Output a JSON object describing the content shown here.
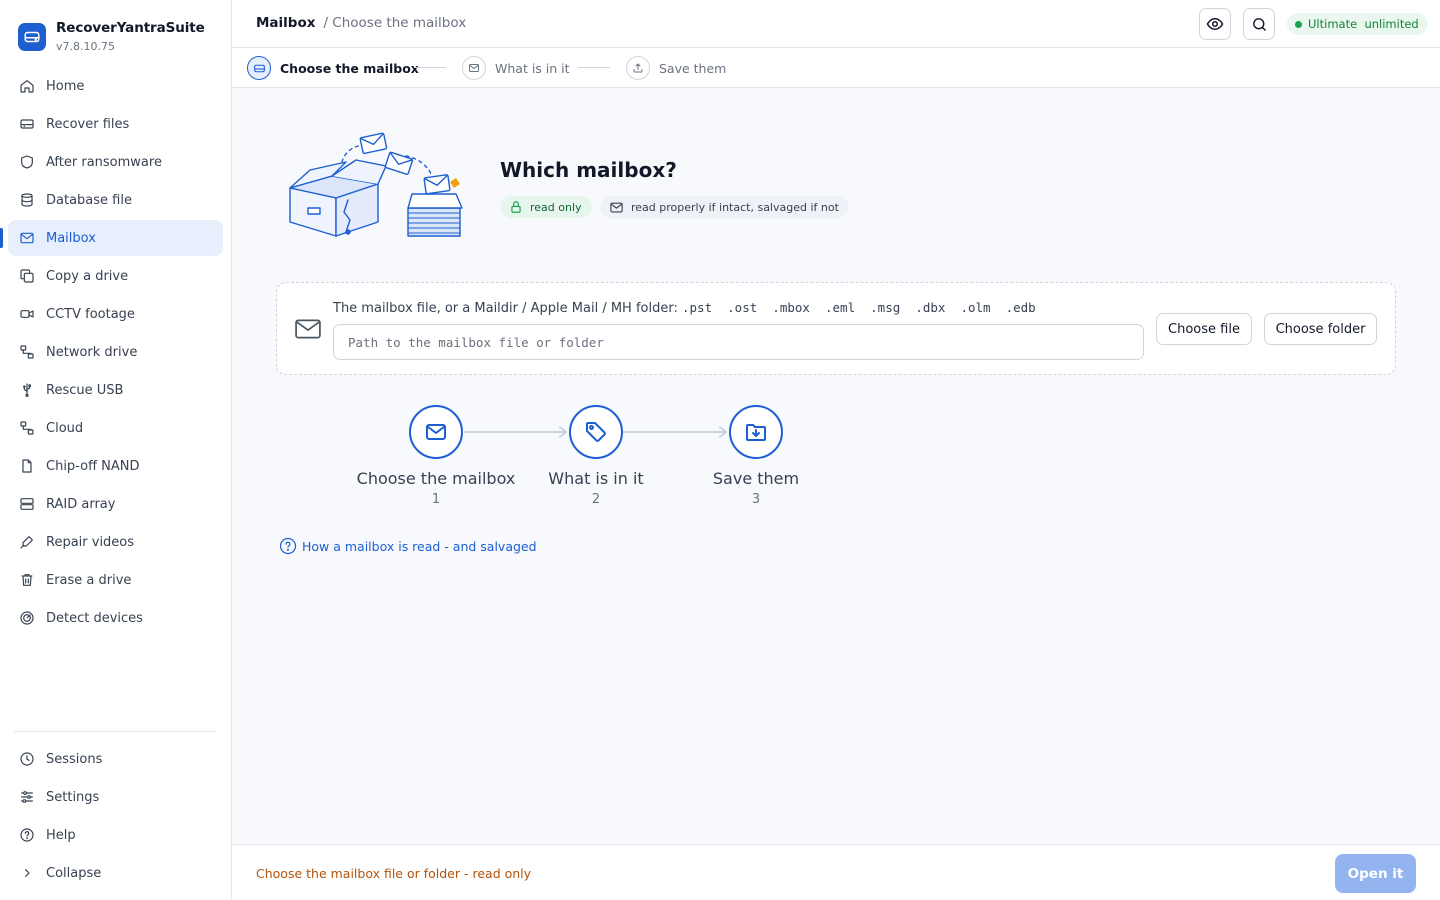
{
  "app": {
    "name": "RecoverYantraSuite",
    "version": "v7.8.10.75"
  },
  "sidebar": {
    "items": [
      {
        "label": "Home",
        "icon": "home-icon"
      },
      {
        "label": "Recover files",
        "icon": "drive-icon"
      },
      {
        "label": "After ransomware",
        "icon": "shield-icon"
      },
      {
        "label": "Database file",
        "icon": "database-icon"
      },
      {
        "label": "Mailbox",
        "icon": "mail-icon",
        "active": true
      },
      {
        "label": "Copy a drive",
        "icon": "copy-icon"
      },
      {
        "label": "CCTV footage",
        "icon": "camera-icon"
      },
      {
        "label": "Network drive",
        "icon": "network-icon"
      },
      {
        "label": "Rescue USB",
        "icon": "usb-icon"
      },
      {
        "label": "Cloud",
        "icon": "cloud-icon"
      },
      {
        "label": "Chip-off NAND",
        "icon": "chip-icon"
      },
      {
        "label": "RAID array",
        "icon": "raid-icon"
      },
      {
        "label": "Repair videos",
        "icon": "repair-icon"
      },
      {
        "label": "Erase a drive",
        "icon": "trash-icon"
      },
      {
        "label": "Detect devices",
        "icon": "radar-icon"
      }
    ],
    "bottom": [
      {
        "label": "Sessions",
        "icon": "clock-icon"
      },
      {
        "label": "Settings",
        "icon": "sliders-icon"
      },
      {
        "label": "Help",
        "icon": "help-icon"
      },
      {
        "label": "Collapse",
        "icon": "chevron-right-icon"
      }
    ]
  },
  "header": {
    "crumb_root": "Mailbox",
    "crumb_current": "/ Choose the mailbox",
    "plan_label": "Ultimate  unlimited"
  },
  "stepper": {
    "steps": [
      {
        "label": "Choose the mailbox",
        "active": true
      },
      {
        "label": "What is in it"
      },
      {
        "label": "Save them"
      }
    ]
  },
  "hero": {
    "title": "Which mailbox?",
    "badge_readonly": "read only",
    "badge_mode": "read properly if intact, salvaged if not"
  },
  "source": {
    "label": "The mailbox file, or a Maildir / Apple Mail / MH folder:",
    "extensions": ".pst  .ost  .mbox  .eml  .msg  .dbx  .olm  .edb",
    "placeholder": "Path to the mailbox file or folder",
    "value": "",
    "choose_file": "Choose file",
    "choose_folder": "Choose folder"
  },
  "flow": [
    {
      "label": "Choose the mailbox",
      "num": "1",
      "icon": "mail-icon"
    },
    {
      "label": "What is in it",
      "num": "2",
      "icon": "tag-icon"
    },
    {
      "label": "Save them",
      "num": "3",
      "icon": "folder-download-icon"
    }
  ],
  "help_link": "How a mailbox is read - and salvaged",
  "footer": {
    "status": "Choose the mailbox file or folder - read only",
    "open_button": "Open it"
  },
  "colors": {
    "accent": "#1d5fd0",
    "active_bg": "#e8effc",
    "success": "#16a34a",
    "warning_text": "#b45309",
    "disabled_button": "#93b4ee"
  }
}
